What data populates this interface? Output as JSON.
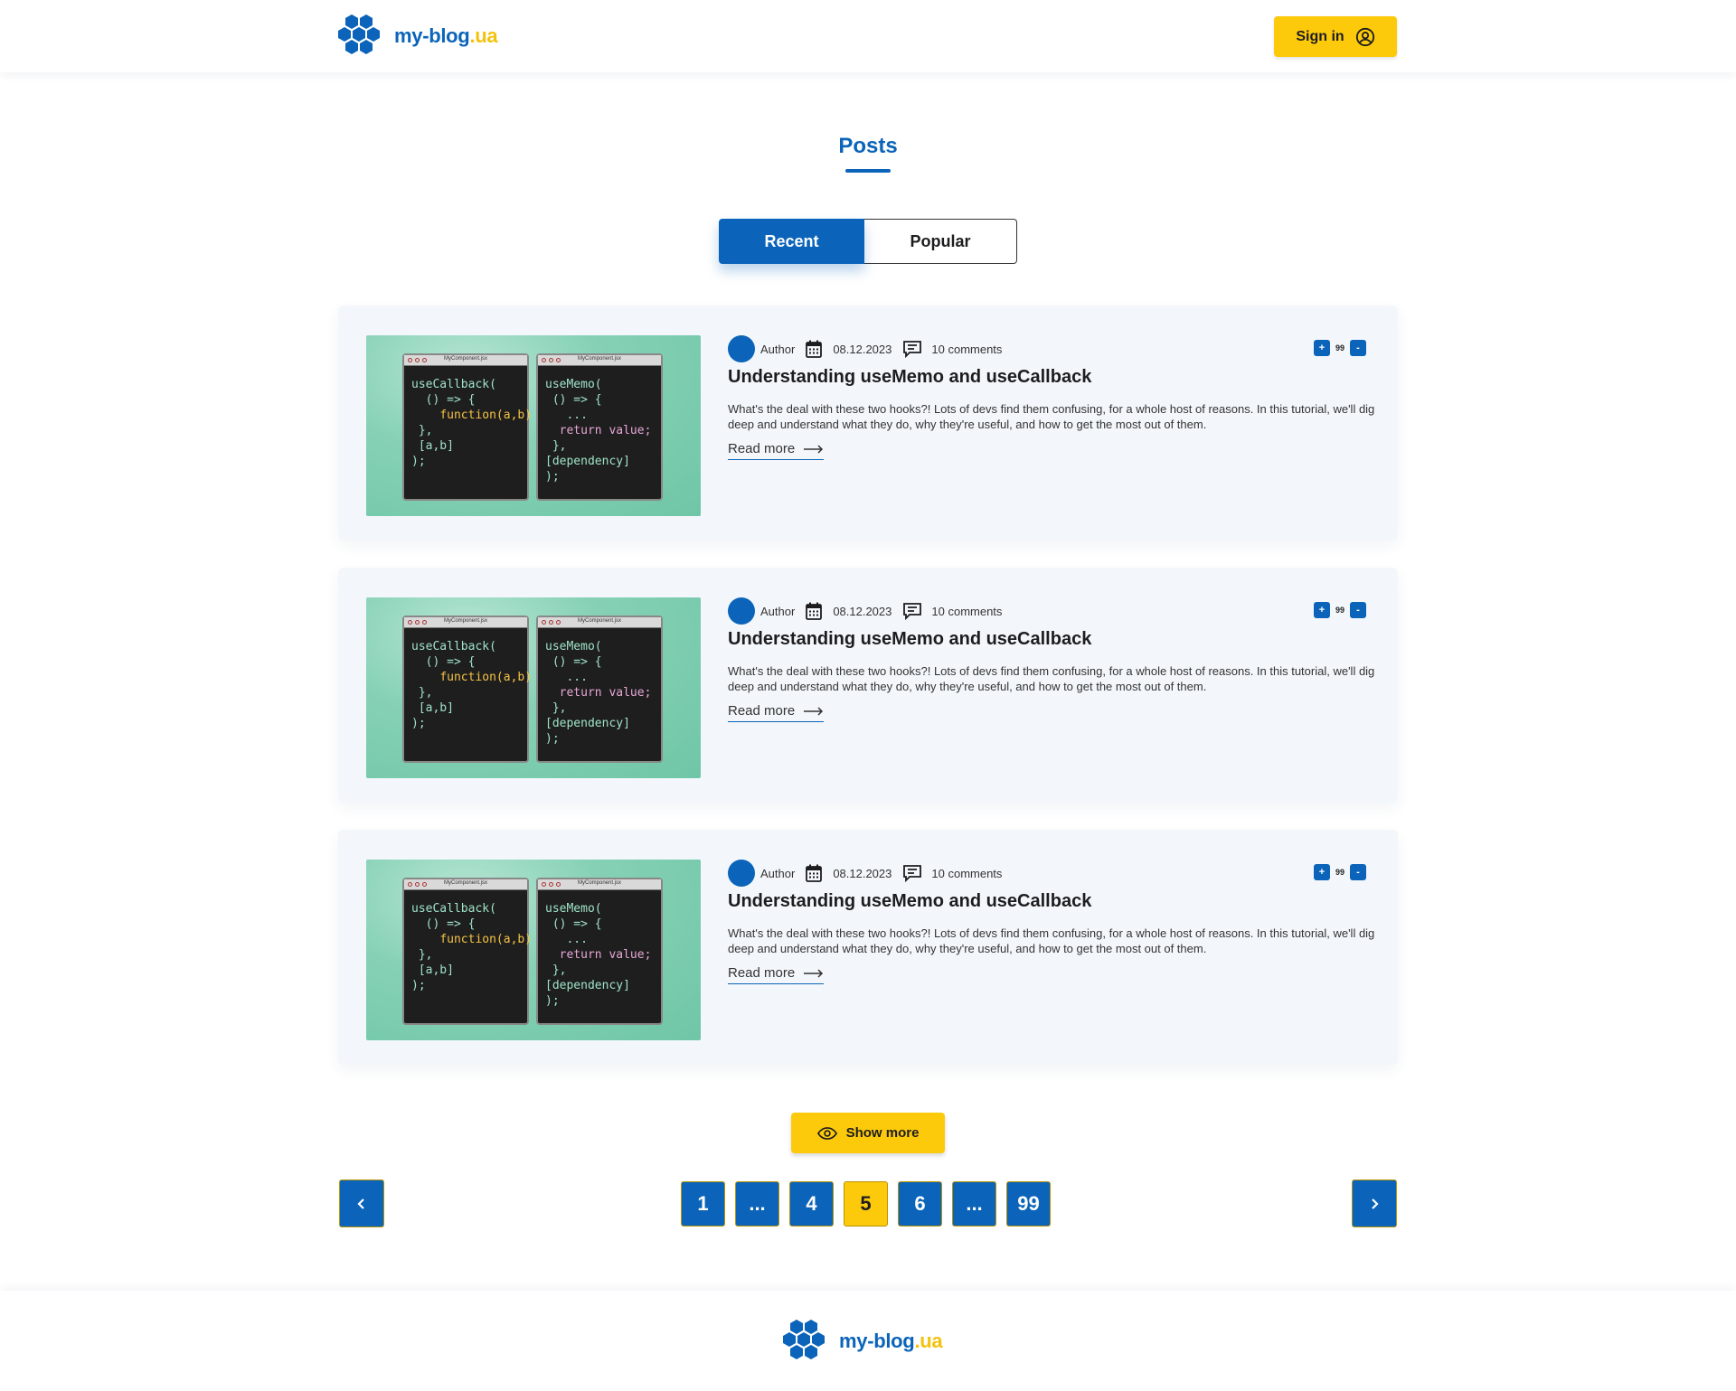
{
  "brand": {
    "name": "my-blog",
    "tld": ".ua"
  },
  "header": {
    "signin_label": "Sign in",
    "user_icon": "user-circle-icon"
  },
  "page": {
    "title": "Posts"
  },
  "tabs": [
    {
      "label": "Recent",
      "active": true
    },
    {
      "label": "Popular",
      "active": false
    }
  ],
  "posts": [
    {
      "author": "Author",
      "date": "08.12.2023",
      "comments": "10 comments",
      "votes": {
        "up": "+",
        "count": "99",
        "down": "-"
      },
      "title": "Understanding useMemo and useCallback",
      "excerpt": "What's the deal with these two hooks?! Lots of devs find them confusing, for a whole host of reasons. In this tutorial, we'll dig deep and understand what they do, why they're useful, and how to get the most out of them.",
      "read_more": "Read more"
    },
    {
      "author": "Author",
      "date": "08.12.2023",
      "comments": "10 comments",
      "votes": {
        "up": "+",
        "count": "99",
        "down": "-"
      },
      "title": "Understanding useMemo and useCallback",
      "excerpt": "What's the deal with these two hooks?! Lots of devs find them confusing, for a whole host of reasons. In this tutorial, we'll dig deep and understand what they do, why they're useful, and how to get the most out of them.",
      "read_more": "Read more"
    },
    {
      "author": "Author",
      "date": "08.12.2023",
      "comments": "10 comments",
      "votes": {
        "up": "+",
        "count": "99",
        "down": "-"
      },
      "title": "Understanding useMemo and useCallback",
      "excerpt": "What's the deal with these two hooks?! Lots of devs find them confusing, for a whole host of reasons. In this tutorial, we'll dig deep and understand what they do, why they're useful, and how to get the most out of them.",
      "read_more": "Read more"
    }
  ],
  "thumbnail_code": {
    "file_label": "MyComponent.jsx",
    "left": [
      "useCallback(",
      "() => {",
      "function(a,b)",
      "},",
      "[a,b]",
      ");"
    ],
    "right": [
      "useMemo(",
      "() => {",
      "...",
      "return value;",
      "},",
      "[dependency]",
      ");"
    ]
  },
  "show_more": {
    "label": "Show more",
    "icon": "eye-icon"
  },
  "pagination": {
    "pages": [
      "1",
      "...",
      "4",
      "5",
      "6",
      "...",
      "99"
    ],
    "current": "5"
  },
  "colors": {
    "primary": "#0b64b9",
    "accent": "#fdc90b",
    "card_bg": "#f3f7fb"
  }
}
